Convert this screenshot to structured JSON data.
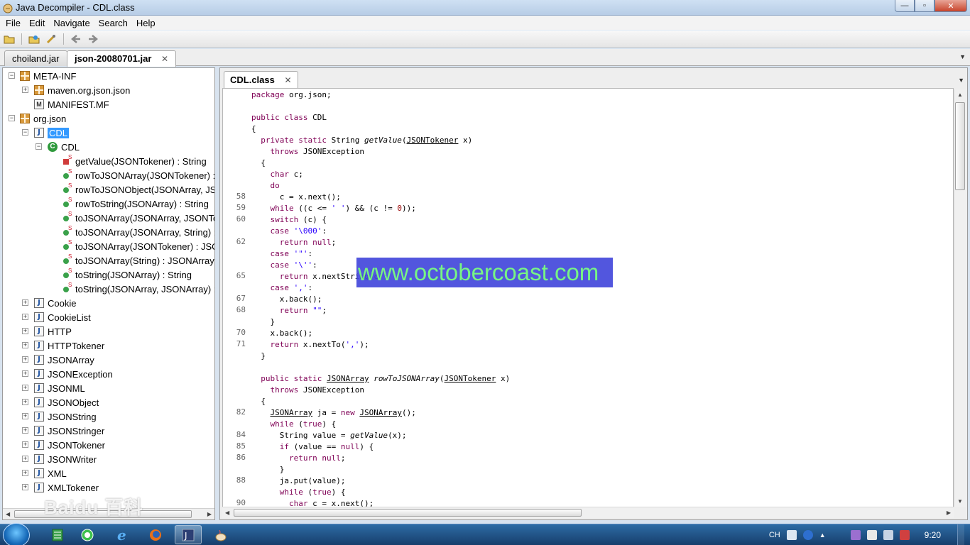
{
  "window": {
    "title": "Java Decompiler - CDL.class",
    "min": "—",
    "max": "▫",
    "close": "✕"
  },
  "menu": [
    "File",
    "Edit",
    "Navigate",
    "Search",
    "Help"
  ],
  "jar_tabs": [
    {
      "label": "choiland.jar"
    },
    {
      "label": "json-20080701.jar",
      "close": "✕"
    }
  ],
  "tree": {
    "meta_inf": "META-INF",
    "maven": "maven.org.json.json",
    "manifest": "MANIFEST.MF",
    "org_json": "org.json",
    "cdl_file": "CDL",
    "cdl_class": "CDL",
    "methods": [
      "getValue(JSONTokener) : String",
      "rowToJSONArray(JSONTokener) :",
      "rowToJSONObject(JSONArray, JSO",
      "rowToString(JSONArray) : String",
      "toJSONArray(JSONArray, JSONTo",
      "toJSONArray(JSONArray, String) :",
      "toJSONArray(JSONTokener) : JSO",
      "toJSONArray(String) : JSONArray",
      "toString(JSONArray) : String",
      "toString(JSONArray, JSONArray) :"
    ],
    "classes": [
      "Cookie",
      "CookieList",
      "HTTP",
      "HTTPTokener",
      "JSONArray",
      "JSONException",
      "JSONML",
      "JSONObject",
      "JSONString",
      "JSONStringer",
      "JSONTokener",
      "JSONWriter",
      "XML",
      "XMLTokener"
    ]
  },
  "editor": {
    "tab_label": "CDL.class",
    "tab_close": "✕",
    "line_numbers": {
      "l58": "58",
      "l59": "59",
      "l60": "60",
      "l62": "62",
      "l65": "65",
      "l67": "67",
      "l68": "68",
      "l70": "70",
      "l71": "71",
      "l82": "82",
      "l84": "84",
      "l85": "85",
      "l86": "86",
      "l88": "88",
      "l90": "90"
    }
  },
  "overlay": {
    "watermark": "www.octobercoast.com",
    "baidu": "Baidu 百科"
  },
  "taskbar": {
    "lang": "CH",
    "clock": "9:20"
  }
}
